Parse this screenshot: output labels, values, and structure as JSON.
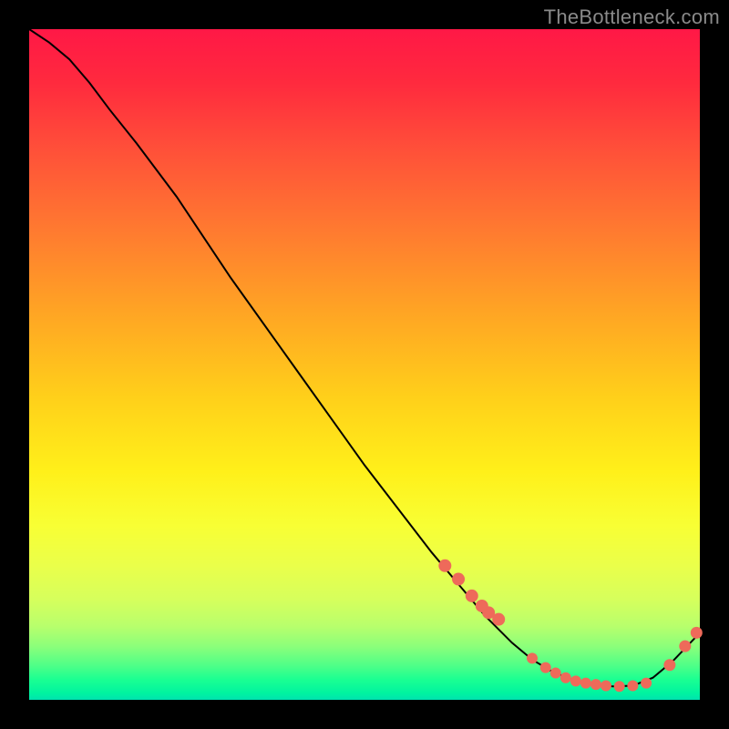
{
  "watermark": "TheBottleneck.com",
  "colors": {
    "dot": "#ee6a5a",
    "curve": "#000000"
  },
  "chart_data": {
    "type": "line",
    "title": "",
    "xlabel": "",
    "ylabel": "",
    "xlim": [
      0,
      100
    ],
    "ylim": [
      0,
      100
    ],
    "x": [
      0,
      3,
      6,
      9,
      12,
      16,
      22,
      30,
      40,
      50,
      60,
      68,
      72,
      75,
      78,
      81,
      84,
      87,
      90,
      93,
      96,
      100
    ],
    "values": [
      100,
      98,
      95.5,
      92,
      88,
      83,
      75,
      63,
      49,
      35,
      22,
      12.5,
      8.5,
      6,
      4.2,
      3,
      2.3,
      2,
      2.1,
      3.3,
      5.8,
      10
    ],
    "overlay_points": {
      "x": [
        62,
        64,
        66,
        67.5,
        68.5,
        70,
        75,
        77,
        78.5,
        80,
        81.5,
        83,
        84.5,
        86,
        88,
        90,
        92,
        95.5,
        97.8,
        99.5
      ],
      "y": [
        20,
        18,
        15.5,
        14,
        13,
        12,
        6.2,
        4.8,
        4,
        3.3,
        2.8,
        2.5,
        2.3,
        2.1,
        2,
        2.1,
        2.5,
        5.2,
        8,
        10
      ]
    }
  }
}
